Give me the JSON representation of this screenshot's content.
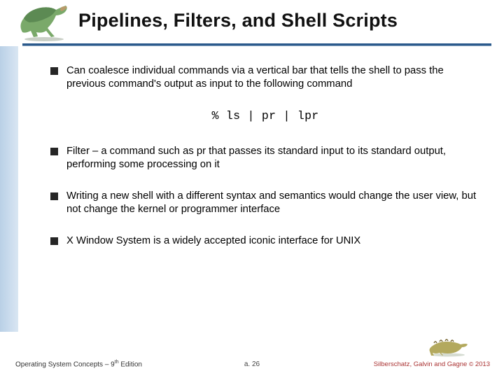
{
  "title": "Pipelines, Filters, and Shell Scripts",
  "bullets": [
    "Can coalesce individual commands via a vertical bar that tells the shell to pass the previous command's output as input to the following command",
    "Filter – a command such as pr that passes its standard input to its standard output, performing some processing on it",
    "Writing a new shell with a different syntax and semantics would change the user view, but not change the kernel or programmer interface",
    "X Window System is a widely accepted iconic interface for UNIX"
  ],
  "code": "% ls | pr | lpr",
  "footer": {
    "left_part1": "Operating System Concepts – 9",
    "left_sup": "th",
    "left_part2": " Edition",
    "center": "a. 26",
    "right_authors": "Silberschatz, Galvin and Gagne",
    "copyright_symbol": "©",
    "right_year": " 2013"
  }
}
